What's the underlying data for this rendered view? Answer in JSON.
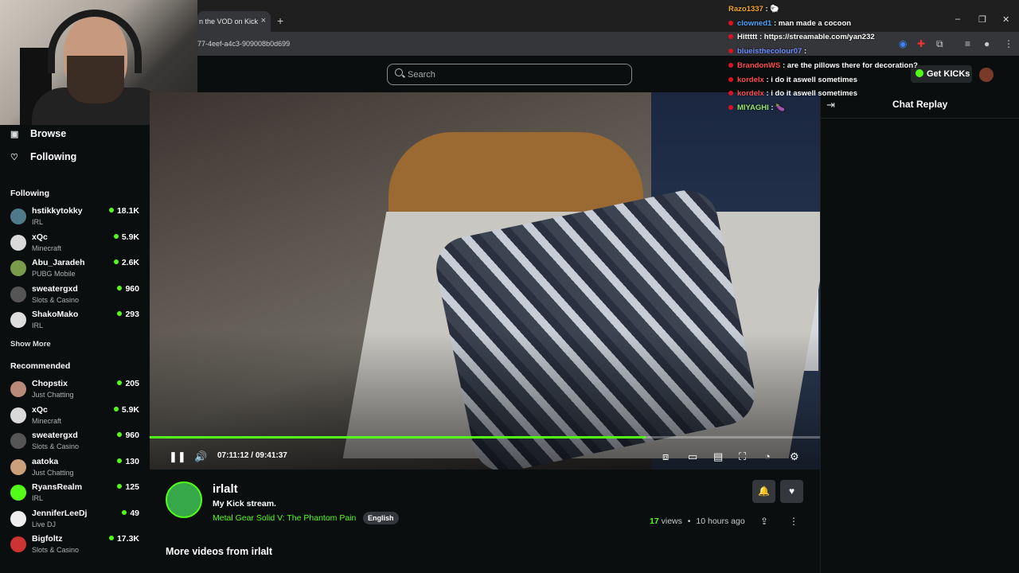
{
  "browser": {
    "tab_title": "n the VOD on Kick",
    "tab_close": "×",
    "new_tab": "+",
    "url": "77-4eef-a4c3-909008b0d699",
    "minimize": "–",
    "maximize": "❐",
    "close": "✕"
  },
  "header": {
    "search_placeholder": "Search",
    "get_kicks": "Get KICKs"
  },
  "sidebar": {
    "browse": "Browse",
    "following_nav": "Following",
    "following_heading": "Following",
    "following": [
      {
        "name": "hstikkytokky",
        "category": "IRL",
        "viewers": "18.1K",
        "color": "#4f7a8c"
      },
      {
        "name": "xQc",
        "category": "Minecraft",
        "viewers": "5.9K",
        "color": "#d9d9d9"
      },
      {
        "name": "Abu_Jaradeh",
        "category": "PUBG Mobile",
        "viewers": "2.6K",
        "color": "#7a9b4a"
      },
      {
        "name": "sweatergxd",
        "category": "Slots & Casino",
        "viewers": "960",
        "color": "#555"
      },
      {
        "name": "ShakoMako",
        "category": "IRL",
        "viewers": "293",
        "color": "#ddd"
      }
    ],
    "show_more": "Show More",
    "recommended_heading": "Recommended",
    "recommended": [
      {
        "name": "Chopstix",
        "category": "Just Chatting",
        "viewers": "205",
        "color": "#b98a7a"
      },
      {
        "name": "xQc",
        "category": "Minecraft",
        "viewers": "5.9K",
        "color": "#d9d9d9"
      },
      {
        "name": "sweatergxd",
        "category": "Slots & Casino",
        "viewers": "960",
        "color": "#555"
      },
      {
        "name": "aatoka",
        "category": "Just Chatting",
        "viewers": "130",
        "color": "#c9a07a"
      },
      {
        "name": "RyansRealm",
        "category": "IRL",
        "viewers": "125",
        "color": "#53fc18"
      },
      {
        "name": "JenniferLeeDj",
        "category": "Live DJ",
        "viewers": "49",
        "color": "#eee"
      },
      {
        "name": "Bigfoltz",
        "category": "Slots & Casino",
        "viewers": "17.3K",
        "color": "#c33"
      }
    ]
  },
  "player": {
    "current_time": "07:11:12",
    "separator": "/",
    "duration": "09:41:37",
    "progress": 0.74,
    "accent": "#53fc18"
  },
  "chat_overlay": [
    {
      "user": "Razo1337",
      "text": ": 🐑",
      "color": "#f5a623",
      "dot": false
    },
    {
      "user": "clowned1",
      "text": ": man made a cocoon",
      "color": "#4aa3ff",
      "dot": true
    },
    {
      "user": "Hittttt",
      "text": ": https://streamable.com/yan232",
      "color": "#ffffff",
      "dot": true
    },
    {
      "user": "blueisthecolour07",
      "text": ":",
      "color": "#6b8cff",
      "dot": true
    },
    {
      "user": "BrandonWS",
      "text": ": are the pillows there for decoration?",
      "color": "#ff4d4d",
      "dot": true
    },
    {
      "user": "kordelx",
      "text": ": i do it aswell sometimes",
      "color": "#ff4d4d",
      "dot": true
    },
    {
      "user": "kordelx",
      "text": ": i do it aswell sometimes",
      "color": "#ff4d4d",
      "dot": true
    },
    {
      "user": "MIYAGHI",
      "text": ": 🍆",
      "color": "#9be36b",
      "dot": true
    }
  ],
  "chat_panel": {
    "title": "Chat Replay"
  },
  "channel": {
    "name": "irlalt",
    "description": "My Kick stream.",
    "game": "Metal Gear Solid V: The Phantom Pain",
    "language": "English",
    "views_count": "17",
    "views_label": "views",
    "bullet": "•",
    "ago": "10 hours ago"
  },
  "more_videos": "More videos from irlalt"
}
